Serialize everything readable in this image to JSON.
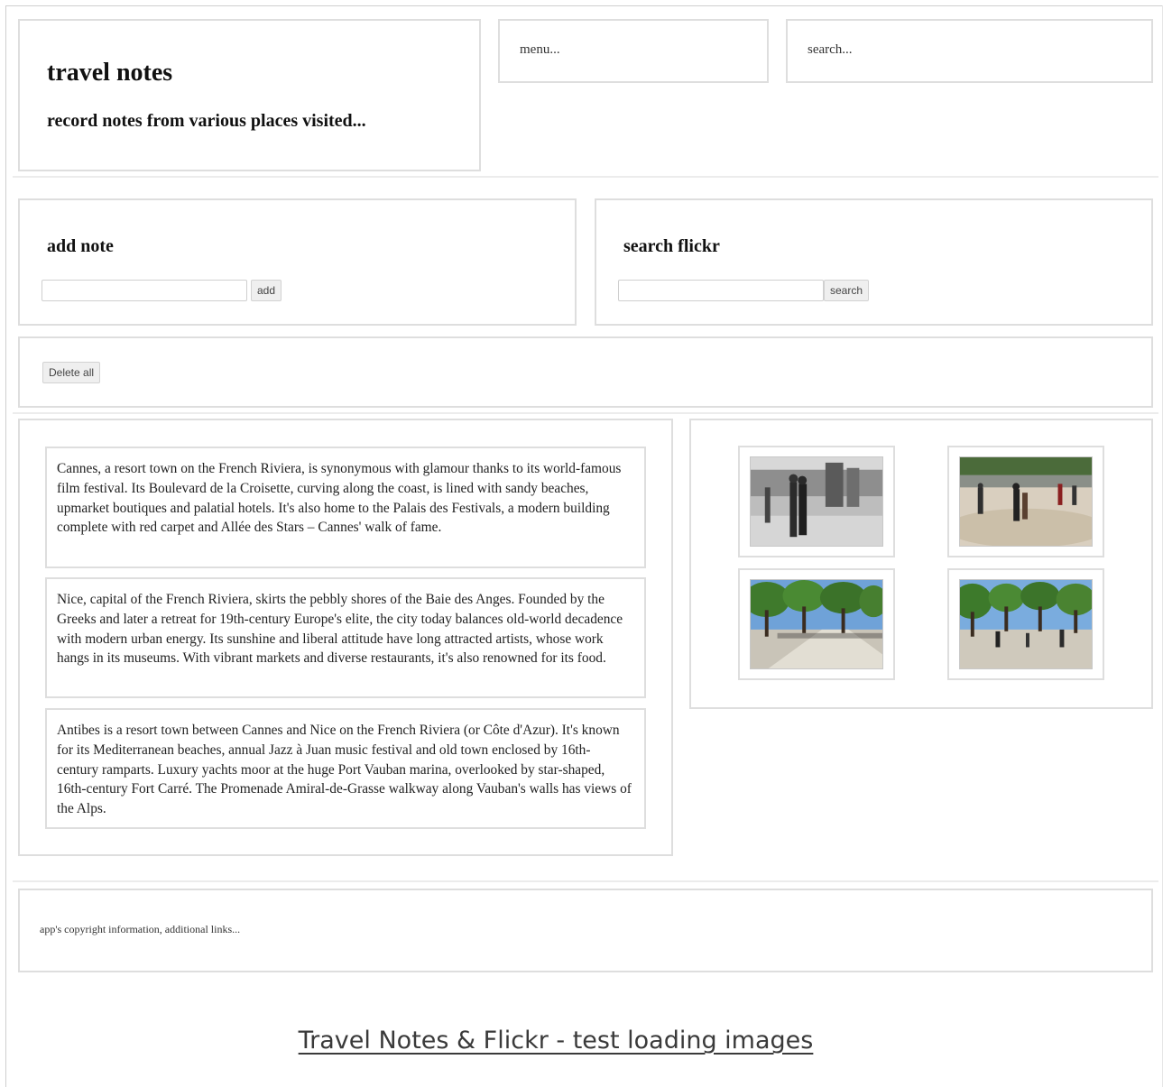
{
  "header": {
    "title": "travel notes",
    "tagline": "record notes from various places visited...",
    "menu_placeholder": "menu...",
    "search_placeholder": "search..."
  },
  "add_note": {
    "heading": "add note",
    "input_value": "",
    "button_label": "add"
  },
  "search_flickr": {
    "heading": "search flickr",
    "input_value": "",
    "button_label": "search"
  },
  "controls": {
    "delete_all_label": "Delete all"
  },
  "notes": [
    {
      "text": "Cannes, a resort town on the French Riviera, is synonymous with glamour thanks to its world-famous film festival. Its Boulevard de la Croisette, curving along the coast, is lined with sandy beaches, upmarket boutiques and palatial hotels. It's also home to the Palais des Festivals, a modern building complete with red carpet and Allée des Stars – Cannes' walk of fame."
    },
    {
      "text": "Nice, capital of the French Riviera, skirts the pebbly shores of the Baie des Anges. Founded by the Greeks and later a retreat for 19th-century Europe's elite, the city today balances old-world decadence with modern urban energy. Its sunshine and liberal attitude have long attracted artists, whose work hangs in its museums. With vibrant markets and diverse restaurants, it's also renowned for its food."
    },
    {
      "text": "Antibes is a resort town between Cannes and Nice on the French Riviera (or Côte d'Azur). It's known for its Mediterranean beaches, annual Jazz à Juan music festival and old town enclosed by 16th-century ramparts. Luxury yachts moor at the huge Port Vauban marina, overlooked by star-shaped, 16th-century Fort Carré. The Promenade Amiral-de-Grasse walkway along Vauban's walls has views of the Alps."
    }
  ],
  "footer": {
    "text": "app's copyright information, additional links..."
  },
  "caption": "Travel Notes & Flickr - test loading images",
  "colors": {
    "border": "#dedede",
    "sky": "#6fa2d8",
    "foliage": "#3f7a2c",
    "pavement": "#c9c4b8"
  },
  "icons": [
    "flickr-photo-thumbnail"
  ]
}
